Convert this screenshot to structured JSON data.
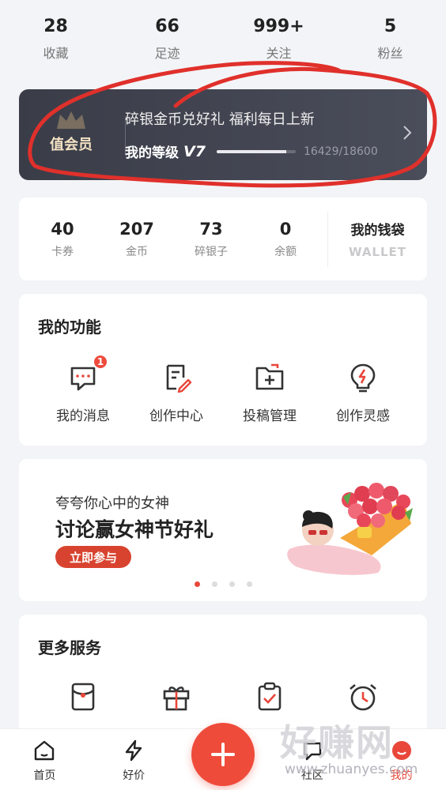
{
  "stats": [
    {
      "value": "28",
      "label": "收藏"
    },
    {
      "value": "66",
      "label": "足迹"
    },
    {
      "value": "999+",
      "label": "关注"
    },
    {
      "value": "5",
      "label": "粉丝"
    }
  ],
  "vip": {
    "title": "值会员",
    "promo": "碎银金币兑好礼 福利每日上新",
    "level_label": "我的等级",
    "level_badge": "V7",
    "points": "16429/18600",
    "progress": 0.88
  },
  "wallet": {
    "items": [
      {
        "value": "40",
        "label": "卡券"
      },
      {
        "value": "207",
        "label": "金币"
      },
      {
        "value": "73",
        "label": "碎银子"
      },
      {
        "value": "0",
        "label": "余额"
      }
    ],
    "purse_title": "我的钱袋",
    "purse_sub": "WALLET"
  },
  "functions": {
    "title": "我的功能",
    "items": [
      {
        "label": "我的消息",
        "icon": "message-icon",
        "badge": "1"
      },
      {
        "label": "创作中心",
        "icon": "creation-icon"
      },
      {
        "label": "投稿管理",
        "icon": "folder-add-icon"
      },
      {
        "label": "创作灵感",
        "icon": "lightbulb-icon"
      }
    ]
  },
  "banner": {
    "subtitle": "夸夸你心中的女神",
    "title": "讨论赢女神节好礼",
    "button": "立即参与",
    "dots": 4,
    "active_dot": 0
  },
  "more": {
    "title": "更多服务",
    "icons": [
      "red-envelope-icon",
      "gift-icon",
      "clipboard-check-icon",
      "alarm-clock-icon"
    ]
  },
  "tabbar": {
    "items": [
      {
        "label": "首页",
        "icon": "home-icon"
      },
      {
        "label": "好价",
        "icon": "lightning-icon"
      },
      {
        "label": "社区",
        "icon": "community-icon"
      },
      {
        "label": "我的",
        "icon": "profile-icon",
        "active": true
      }
    ]
  },
  "watermark": {
    "logo": "好赚网",
    "url": "www.zhuanyes.com"
  },
  "colors": {
    "accent": "#e8473a",
    "vip_bg": "#3d404b",
    "annotation": "#e0302b"
  }
}
